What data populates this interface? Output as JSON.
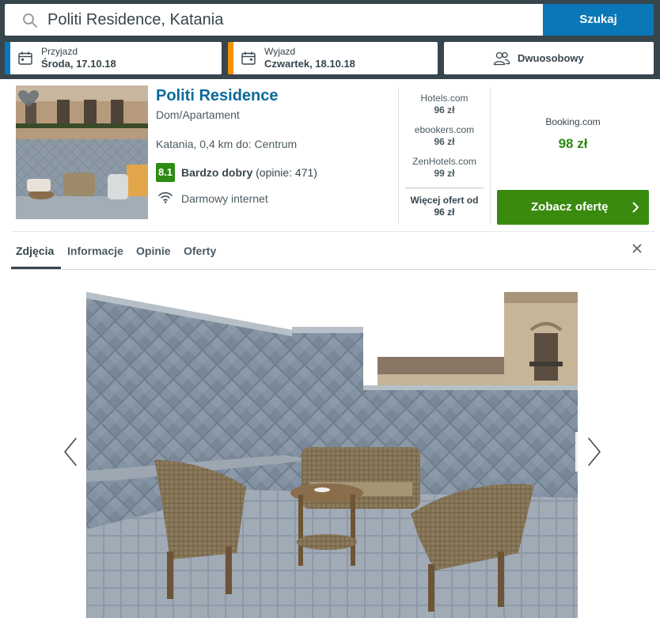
{
  "search": {
    "query": "Politi Residence, Katania",
    "button_label": "Szukaj"
  },
  "checkin": {
    "label": "Przyjazd",
    "value": "Środa, 17.10.18"
  },
  "checkout": {
    "label": "Wyjazd",
    "value": "Czwartek, 18.10.18"
  },
  "room": {
    "value": "Dwuosobowy"
  },
  "hotel": {
    "name": "Politi Residence",
    "type": "Dom/Apartament",
    "location": "Katania, 0,4 km do: Centrum",
    "score": "8.1",
    "rating_label": "Bardzo dobry",
    "reviews": "(opinie: 471)",
    "amenity": "Darmowy internet"
  },
  "offers": [
    {
      "provider": "Hotels.com",
      "price": "96 zł"
    },
    {
      "provider": "ebookers.com",
      "price": "96 zł"
    },
    {
      "provider": "ZenHotels.com",
      "price": "99 zł"
    }
  ],
  "more_offers": {
    "label": "Więcej ofert od",
    "price": "96 zł"
  },
  "best_deal": {
    "provider": "Booking.com",
    "price": "98 zł",
    "button_label": "Zobacz ofertę"
  },
  "tabs": [
    {
      "label": "Zdjęcia",
      "active": true
    },
    {
      "label": "Informacje",
      "active": false
    },
    {
      "label": "Opinie",
      "active": false
    },
    {
      "label": "Oferty",
      "active": false
    }
  ],
  "colors": {
    "accent": "#0a77b8",
    "checkout": "#f39200",
    "deal": "#3a8a10",
    "header": "#37454d"
  },
  "icons": [
    "search-icon",
    "calendar-icon",
    "people-icon",
    "heart-icon",
    "wifi-icon",
    "chevron-right-icon",
    "close-icon",
    "chevron-left-icon"
  ]
}
